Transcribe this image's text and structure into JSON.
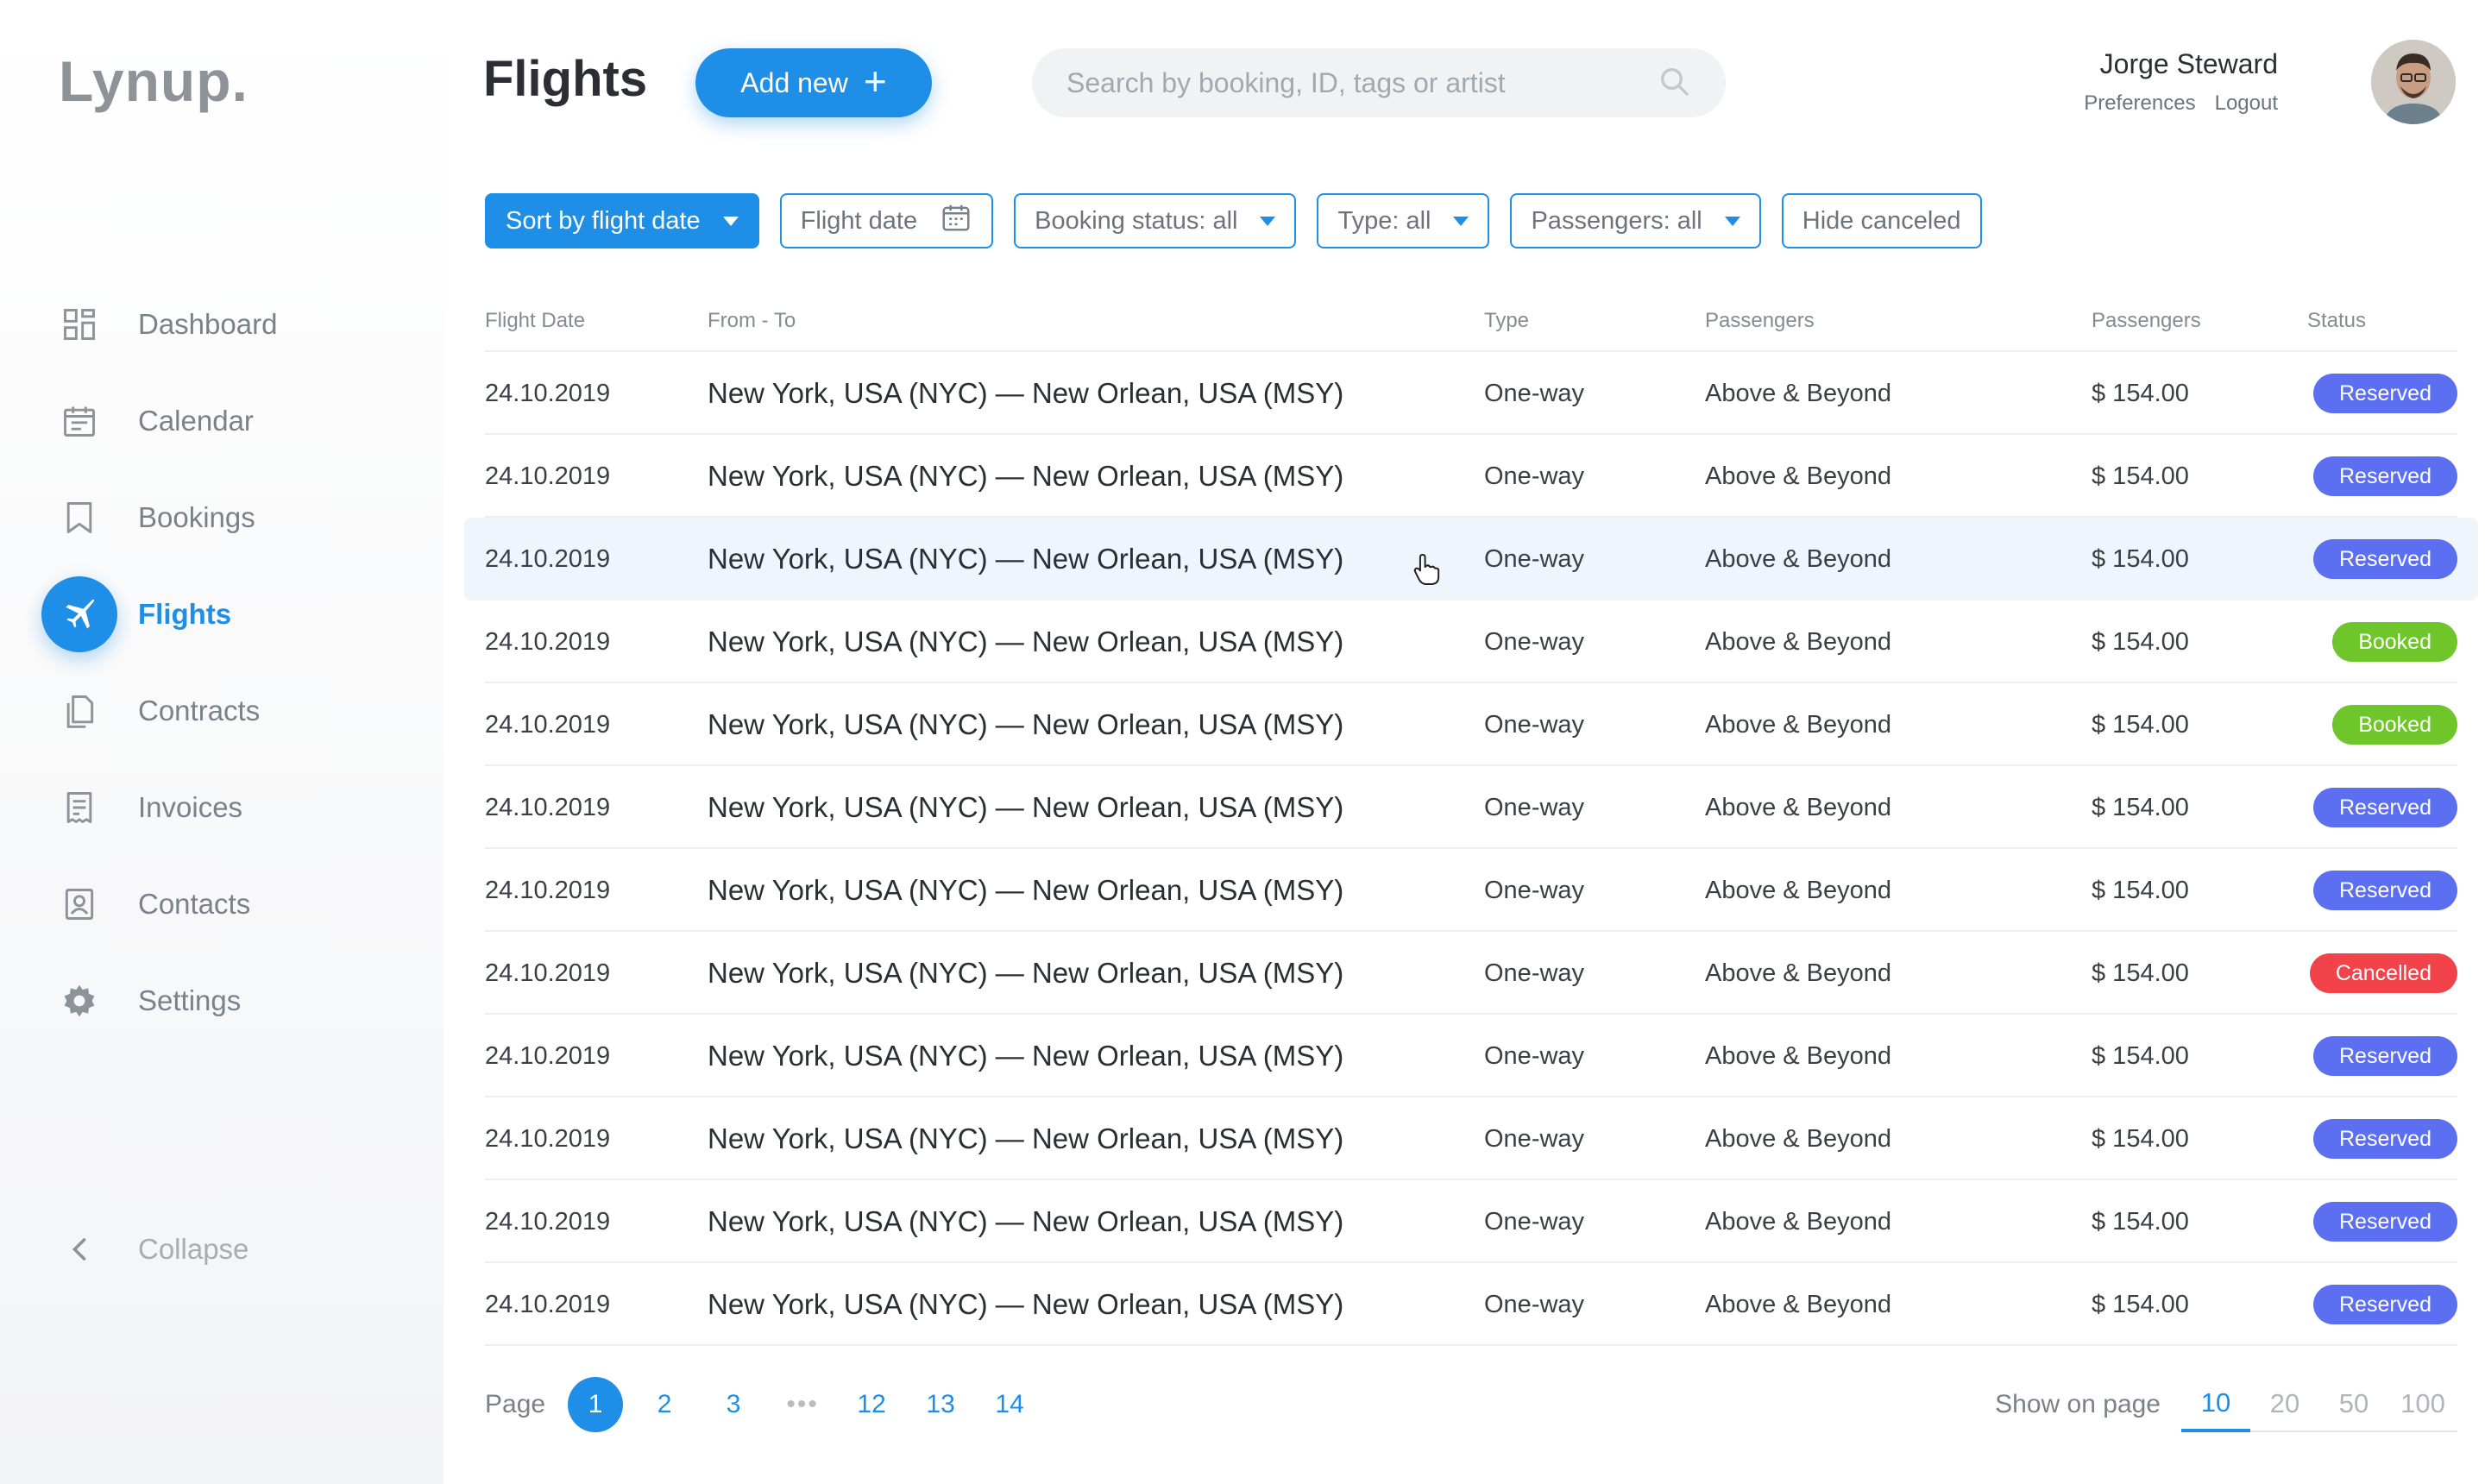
{
  "app": {
    "logo": "Lynup."
  },
  "sidebar": {
    "items": [
      {
        "label": "Dashboard",
        "icon": "dashboard-icon",
        "active": false
      },
      {
        "label": "Calendar",
        "icon": "calendar-icon",
        "active": false
      },
      {
        "label": "Bookings",
        "icon": "bookmark-icon",
        "active": false
      },
      {
        "label": "Flights",
        "icon": "airplane-icon",
        "active": true
      },
      {
        "label": "Contracts",
        "icon": "documents-icon",
        "active": false
      },
      {
        "label": "Invoices",
        "icon": "invoice-icon",
        "active": false
      },
      {
        "label": "Contacts",
        "icon": "contact-card-icon",
        "active": false
      },
      {
        "label": "Settings",
        "icon": "gear-icon",
        "active": false
      }
    ],
    "collapse_label": "Collapse"
  },
  "header": {
    "title": "Flights",
    "add_label": "Add new",
    "search_placeholder": "Search by booking, ID, tags or artist"
  },
  "user": {
    "name": "Jorge Steward",
    "preferences": "Preferences",
    "logout": "Logout"
  },
  "filters": {
    "sort": "Sort by flight date",
    "flight_date": "Flight date",
    "booking_status": "Booking status: all",
    "type": "Type: all",
    "passengers": "Passengers: all",
    "hide_canceled": "Hide canceled"
  },
  "table": {
    "columns": [
      "Flight Date",
      "From - To",
      "Type",
      "Passengers",
      "Passengers",
      "Status"
    ],
    "rows": [
      {
        "date": "24.10.2019",
        "route": "New York, USA (NYC) — New Orlean, USA (MSY)",
        "type": "One-way",
        "passengers": "Above & Beyond",
        "price": "$ 154.00",
        "status": "Reserved"
      },
      {
        "date": "24.10.2019",
        "route": "New York, USA (NYC) — New Orlean, USA (MSY)",
        "type": "One-way",
        "passengers": "Above & Beyond",
        "price": "$ 154.00",
        "status": "Reserved"
      },
      {
        "date": "24.10.2019",
        "route": "New York, USA (NYC) — New Orlean, USA (MSY)",
        "type": "One-way",
        "passengers": "Above & Beyond",
        "price": "$ 154.00",
        "status": "Reserved"
      },
      {
        "date": "24.10.2019",
        "route": "New York, USA (NYC) — New Orlean, USA (MSY)",
        "type": "One-way",
        "passengers": "Above & Beyond",
        "price": "$ 154.00",
        "status": "Booked"
      },
      {
        "date": "24.10.2019",
        "route": "New York, USA (NYC) — New Orlean, USA (MSY)",
        "type": "One-way",
        "passengers": "Above & Beyond",
        "price": "$ 154.00",
        "status": "Booked"
      },
      {
        "date": "24.10.2019",
        "route": "New York, USA (NYC) — New Orlean, USA (MSY)",
        "type": "One-way",
        "passengers": "Above & Beyond",
        "price": "$ 154.00",
        "status": "Reserved"
      },
      {
        "date": "24.10.2019",
        "route": "New York, USA (NYC) — New Orlean, USA (MSY)",
        "type": "One-way",
        "passengers": "Above & Beyond",
        "price": "$ 154.00",
        "status": "Reserved"
      },
      {
        "date": "24.10.2019",
        "route": "New York, USA (NYC) — New Orlean, USA (MSY)",
        "type": "One-way",
        "passengers": "Above & Beyond",
        "price": "$ 154.00",
        "status": "Cancelled"
      },
      {
        "date": "24.10.2019",
        "route": "New York, USA (NYC) — New Orlean, USA (MSY)",
        "type": "One-way",
        "passengers": "Above & Beyond",
        "price": "$ 154.00",
        "status": "Reserved"
      },
      {
        "date": "24.10.2019",
        "route": "New York, USA (NYC) — New Orlean, USA (MSY)",
        "type": "One-way",
        "passengers": "Above & Beyond",
        "price": "$ 154.00",
        "status": "Reserved"
      },
      {
        "date": "24.10.2019",
        "route": "New York, USA (NYC) — New Orlean, USA (MSY)",
        "type": "One-way",
        "passengers": "Above & Beyond",
        "price": "$ 154.00",
        "status": "Reserved"
      },
      {
        "date": "24.10.2019",
        "route": "New York, USA (NYC) — New Orlean, USA (MSY)",
        "type": "One-way",
        "passengers": "Above & Beyond",
        "price": "$ 154.00",
        "status": "Reserved"
      }
    ],
    "hover_row_index": 2
  },
  "status_colors": {
    "Reserved": "#5b6ff0",
    "Booked": "#6fc62a",
    "Cancelled": "#f2424a"
  },
  "pagination": {
    "label": "Page",
    "pages": [
      "1",
      "2",
      "3",
      "•••",
      "12",
      "13",
      "14"
    ],
    "current": "1",
    "show_label": "Show on page",
    "per_page_options": [
      "10",
      "20",
      "50",
      "100"
    ],
    "per_page_selected": "10"
  },
  "colors": {
    "accent": "#1f8ee6"
  }
}
